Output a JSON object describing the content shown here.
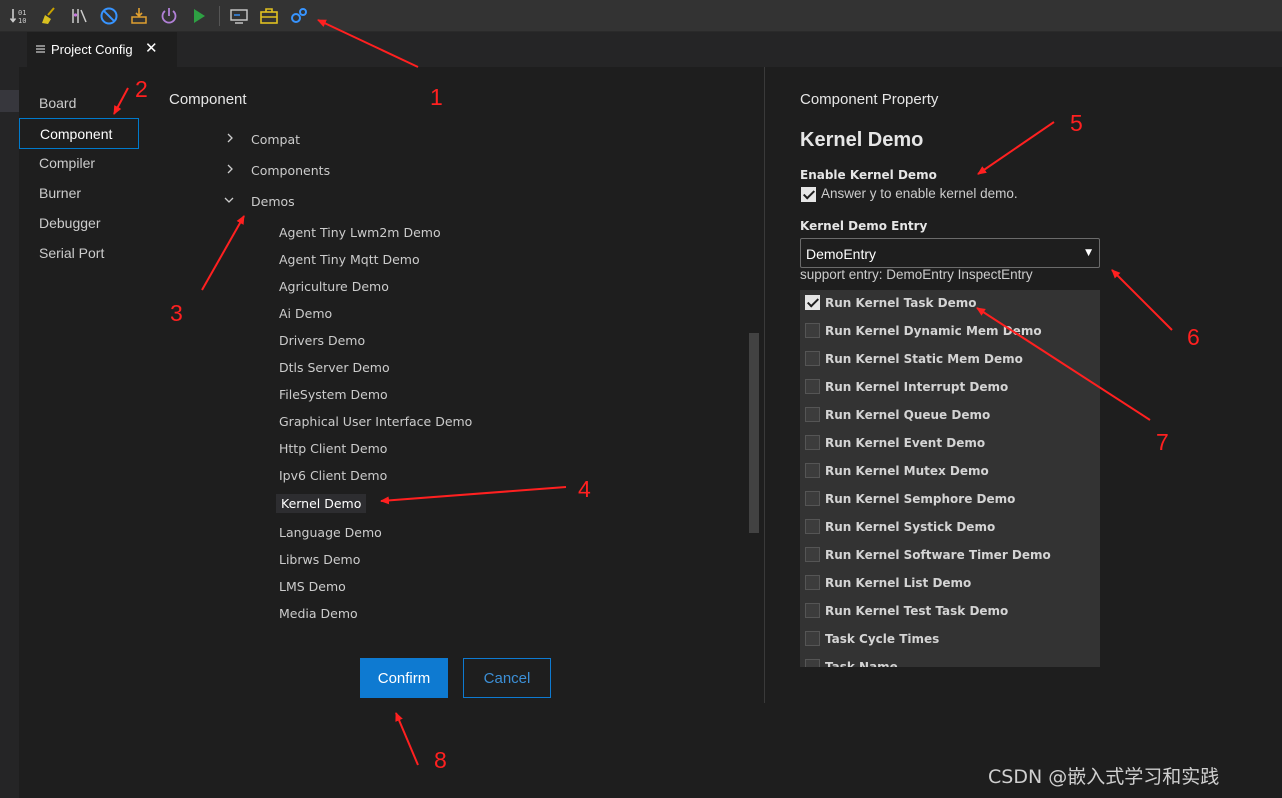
{
  "tab": {
    "label": "Project Config",
    "close": "✕"
  },
  "nav": {
    "items": [
      "Board",
      "Component",
      "Compiler",
      "Burner",
      "Debugger",
      "Serial Port"
    ]
  },
  "component": {
    "heading": "Component",
    "groups": [
      "Compat",
      "Components",
      "Demos"
    ],
    "demos": [
      "Agent Tiny Lwm2m Demo",
      "Agent Tiny Mqtt Demo",
      "Agriculture Demo",
      "Ai Demo",
      "Drivers Demo",
      "Dtls Server Demo",
      "FileSystem Demo",
      "Graphical User Interface Demo",
      "Http Client Demo",
      "Ipv6 Client Demo",
      "Kernel Demo",
      "Language Demo",
      "Librws Demo",
      "LMS Demo",
      "Media Demo"
    ],
    "selected_demo": "Kernel Demo"
  },
  "buttons": {
    "confirm": "Confirm",
    "cancel": "Cancel"
  },
  "property": {
    "heading": "Component Property",
    "title": "Kernel Demo",
    "enable_label": "Enable Kernel Demo",
    "enable_desc": "Answer y to enable kernel demo.",
    "entry_label": "Kernel Demo Entry",
    "entry_value": "DemoEntry",
    "entry_hint": "support entry: DemoEntry InspectEntry",
    "options": [
      {
        "label": "Run Kernel Task Demo",
        "checked": true
      },
      {
        "label": "Run Kernel Dynamic Mem Demo",
        "checked": false
      },
      {
        "label": "Run Kernel Static Mem Demo",
        "checked": false
      },
      {
        "label": "Run Kernel Interrupt Demo",
        "checked": false
      },
      {
        "label": "Run Kernel Queue Demo",
        "checked": false
      },
      {
        "label": "Run Kernel Event Demo",
        "checked": false
      },
      {
        "label": "Run Kernel Mutex Demo",
        "checked": false
      },
      {
        "label": "Run Kernel Semphore Demo",
        "checked": false
      },
      {
        "label": "Run Kernel Systick Demo",
        "checked": false
      },
      {
        "label": "Run Kernel Software Timer Demo",
        "checked": false
      },
      {
        "label": "Run Kernel List Demo",
        "checked": false
      },
      {
        "label": "Run Kernel Test Task Demo",
        "checked": false
      },
      {
        "label": "Task Cycle Times",
        "checked": false
      },
      {
        "label": "Task Name",
        "checked": false
      }
    ]
  },
  "annotations": [
    "1",
    "2",
    "3",
    "4",
    "5",
    "6",
    "7",
    "8"
  ],
  "watermark": "CSDN @嵌入式学习和实践",
  "colors": {
    "accent": "#007acc",
    "annotation": "#ff2020",
    "background": "#1e1e1e"
  }
}
